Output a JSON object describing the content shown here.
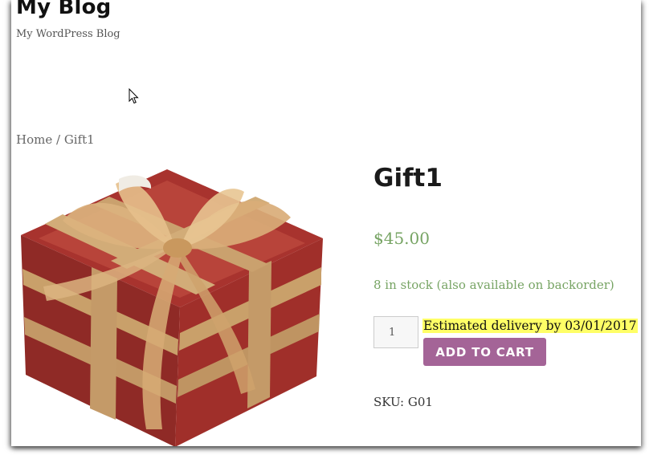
{
  "site": {
    "title": "My Blog",
    "description": "My WordPress Blog"
  },
  "breadcrumb": {
    "home": "Home",
    "separator": " / ",
    "current": "Gift1"
  },
  "product": {
    "title": "Gift1",
    "price": "$45.00",
    "stock": "8 in stock (also available on backorder)",
    "quantity": "1",
    "delivery": "Estimated delivery by 03/01/2017",
    "add_to_cart": "ADD TO CART",
    "sku": "SKU: G01",
    "image": "gift-box-image"
  },
  "colors": {
    "price": "#77a464",
    "button": "#a46497",
    "highlight": "#ffff66"
  }
}
